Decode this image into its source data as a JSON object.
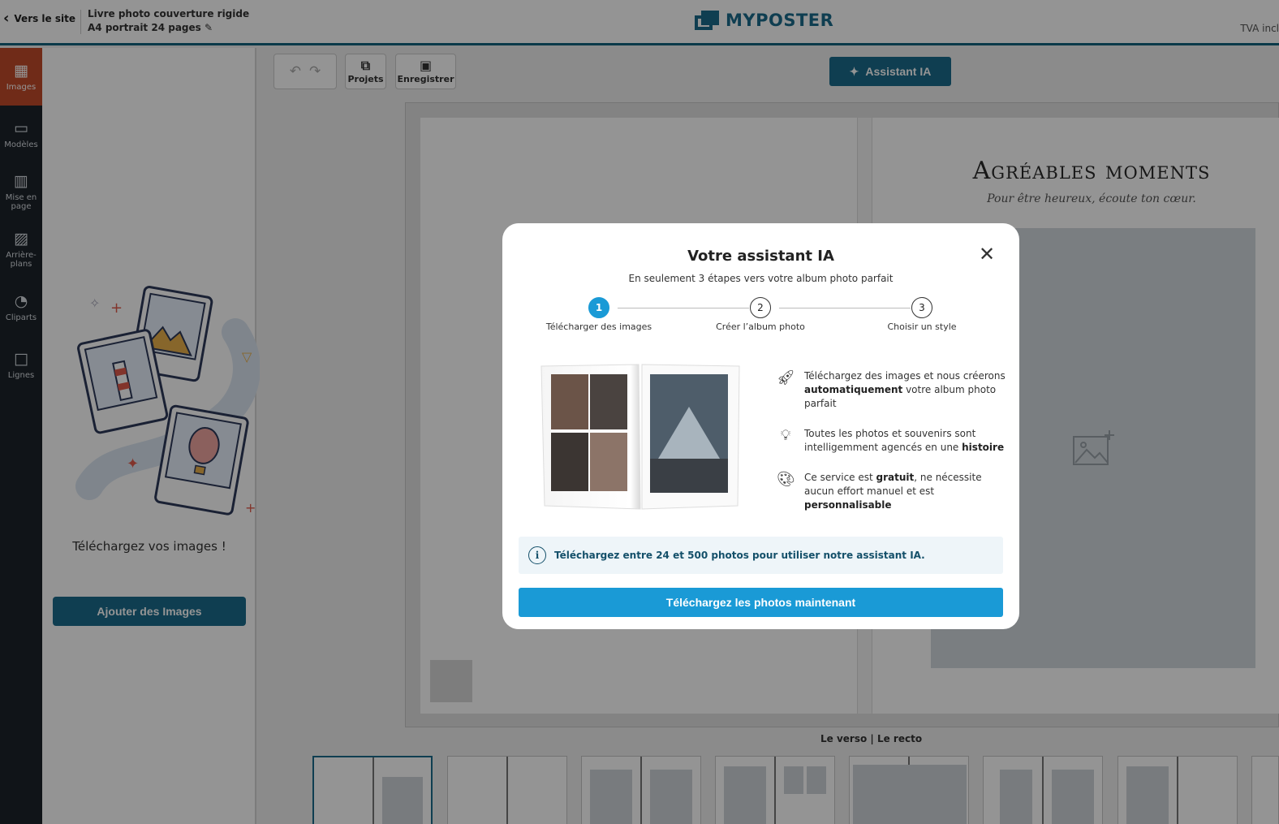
{
  "header": {
    "back_label": "Vers le site",
    "product_line1": "Livre photo couverture rigide",
    "product_line2": "A4 portrait 24 pages",
    "logo": "MYPOSTER",
    "tva": "TVA incl"
  },
  "rail": [
    {
      "label": "Images",
      "icon": "images-icon",
      "active": true
    },
    {
      "label": "Modèles",
      "icon": "book-icon",
      "active": false
    },
    {
      "label": "Mise en page",
      "icon": "layout-icon",
      "active": false
    },
    {
      "label": "Arrière-plans",
      "icon": "background-icon",
      "active": false
    },
    {
      "label": "Cliparts",
      "icon": "clipart-icon",
      "active": false
    },
    {
      "label": "Lignes",
      "icon": "lines-icon",
      "active": false
    }
  ],
  "panel": {
    "upload_text": "Téléchargez vos images !",
    "add_button": "Ajouter des Images"
  },
  "toolbar": {
    "projects": "Projets",
    "save": "Enregistrer",
    "ai_assistant": "Assistant IA"
  },
  "canvas": {
    "title": "Agréables moments",
    "subtitle": "Pour être heureux, écoute ton cœur.",
    "spread_label": "Le verso | Le recto"
  },
  "modal": {
    "title": "Votre assistant IA",
    "subtitle": "En seulement 3 étapes vers votre album photo parfait",
    "steps": [
      {
        "num": "1",
        "label": "Télécharger des images",
        "active": true
      },
      {
        "num": "2",
        "label": "Créer l’album photo",
        "active": false
      },
      {
        "num": "3",
        "label": "Choisir un style",
        "active": false
      }
    ],
    "features": [
      {
        "icon": "rocket-icon",
        "pre": "Téléchargez des images et nous créerons ",
        "bold": "automatiquement",
        "post": " votre album photo parfait"
      },
      {
        "icon": "lightbulb-icon",
        "pre": "Toutes les photos et souvenirs sont intelligemment agencés en une ",
        "bold": "histoire",
        "post": ""
      },
      {
        "icon": "palette-icon",
        "pre": "Ce service est ",
        "bold": "gratuit",
        "mid": ", ne nécessite aucun effort manuel et est ",
        "bold2": "personnalisable"
      }
    ],
    "info_pre": "Téléchargez entre ",
    "info_bold": "24 et 500 photos",
    "info_post": " pour utiliser notre assistant IA.",
    "cta": "Téléchargez les photos maintenant"
  },
  "colors": {
    "brand": "#1a6c8c",
    "accent_blue": "#1a9ad6",
    "rail_active": "#c24a2a",
    "rail_bg": "#1d232a"
  }
}
